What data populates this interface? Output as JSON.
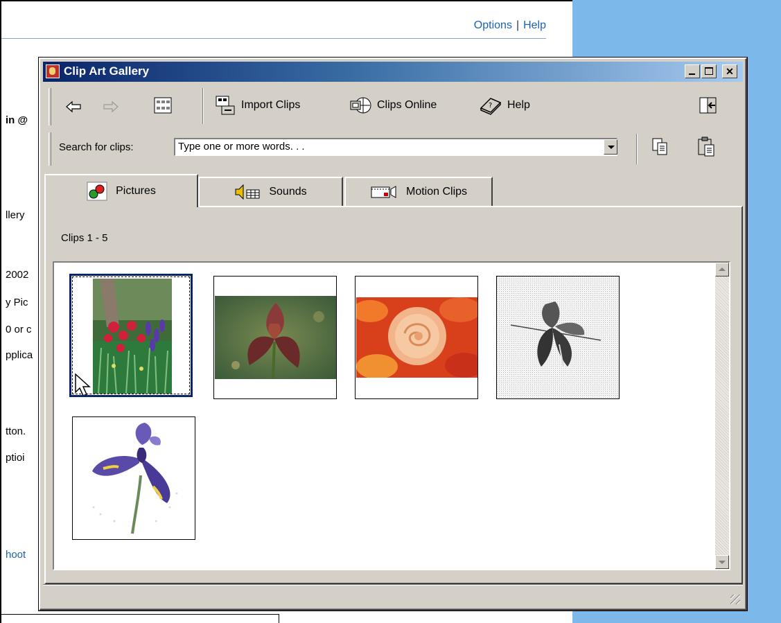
{
  "background_page": {
    "header_links": {
      "options": "Options",
      "separator": "|",
      "help": "Help"
    },
    "text_fragments": [
      "in @",
      "llery",
      "2002",
      "y Pic",
      "0 or c",
      "pplica",
      "tton.",
      "ptioi",
      "hoot"
    ]
  },
  "dialog": {
    "title": "Clip Art Gallery",
    "toolbar": {
      "import_clips": "Import Clips",
      "clips_online": "Clips Online",
      "help": "Help"
    },
    "search": {
      "label": "Search for clips:",
      "value": "Type one or more words. . ."
    },
    "tabs": [
      {
        "label": "Pictures",
        "active": true
      },
      {
        "label": "Sounds",
        "active": false
      },
      {
        "label": "Motion Clips",
        "active": false
      }
    ],
    "clips_count": "Clips 1 - 5",
    "clips": [
      {
        "name": "flower-garden",
        "selected": true
      },
      {
        "name": "brown-iris",
        "selected": false
      },
      {
        "name": "peach-rose",
        "selected": false
      },
      {
        "name": "grayscale-iris",
        "selected": false
      },
      {
        "name": "blue-iris",
        "selected": false
      }
    ]
  },
  "colors": {
    "title_gradient_start": "#0a246a",
    "title_gradient_end": "#a6caf0",
    "dialog_face": "#d4d0c8",
    "link": "#1a62b0",
    "side_panel": "#7db8ea"
  }
}
